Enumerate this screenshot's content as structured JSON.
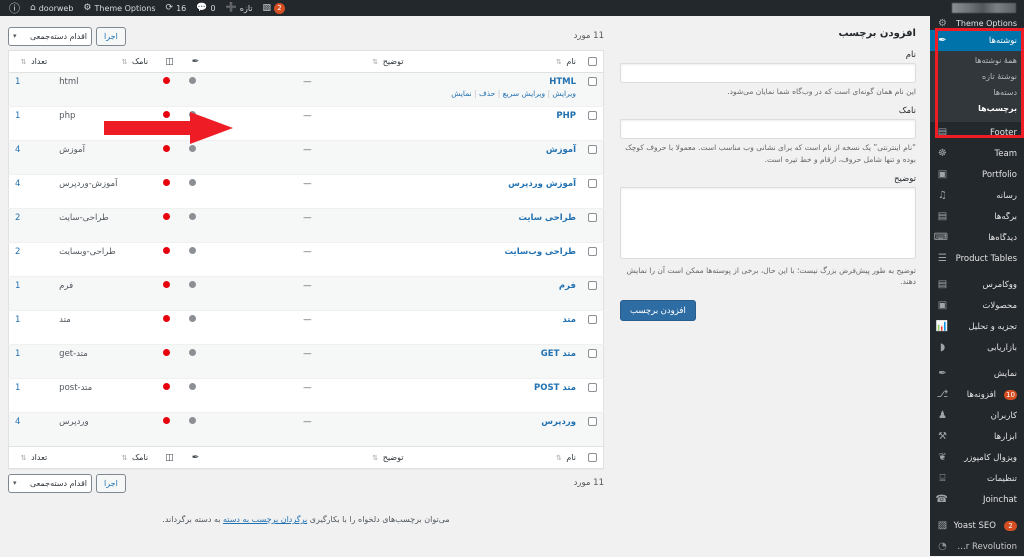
{
  "adminbar": {
    "site_name_redacted": "",
    "right_items": [
      {
        "name": "wp-logo",
        "icon": "wordpress-icon",
        "glyph": "Ⓦ",
        "label": ""
      },
      {
        "name": "site-home",
        "icon": "home-icon",
        "glyph": "⌂",
        "label": ""
      },
      {
        "name": "site-title",
        "icon": "",
        "glyph": "",
        "label": "doorweb"
      },
      {
        "name": "theme-options",
        "icon": "gear-icon",
        "glyph": "⚙",
        "label": "Theme Options"
      },
      {
        "name": "updates",
        "icon": "refresh-icon",
        "glyph": "⟳",
        "label": "16"
      },
      {
        "name": "comments",
        "icon": "comment-icon",
        "glyph": "ὊC",
        "label": "0"
      },
      {
        "name": "new-content",
        "icon": "plus-icon",
        "glyph": "＋",
        "label": "تازه"
      },
      {
        "name": "seo-notifications",
        "icon": "yoast-icon",
        "glyph": "▧",
        "label": "",
        "badge": "2"
      }
    ]
  },
  "sidebar": {
    "items": [
      {
        "label": "نوشته‌ها",
        "icon": "pin-icon",
        "glyph": "✎",
        "current": true,
        "submenu": [
          {
            "label": "همهٔ نوشته‌ها",
            "active": false
          },
          {
            "label": "نوشتهٔ تازه",
            "active": false
          },
          {
            "label": "دسته‌ها",
            "active": false
          },
          {
            "label": "برچسب‌ها",
            "active": true
          }
        ]
      },
      {
        "label": "Footer",
        "icon": "book-icon",
        "glyph": "▤"
      },
      {
        "label": "Team",
        "icon": "people-icon",
        "glyph": "☸"
      },
      {
        "label": "Portfolio",
        "icon": "image-icon",
        "glyph": "▣"
      },
      {
        "label": "رسانه",
        "icon": "media-icon",
        "glyph": "♫"
      },
      {
        "label": "برگه‌ها",
        "icon": "page-icon",
        "glyph": "▤"
      },
      {
        "label": "دیدگاه‌ها",
        "icon": "comment-icon",
        "glyph": "⌨"
      },
      {
        "label": "Product Tables",
        "icon": "list-icon",
        "glyph": "☰"
      },
      {
        "separator": true
      },
      {
        "label": "ووکامرس",
        "icon": "cart-icon",
        "glyph": "▤"
      },
      {
        "label": "محصولات",
        "icon": "box-icon",
        "glyph": "▣"
      },
      {
        "label": "تجزیه و تحلیل",
        "icon": "chart-icon",
        "glyph": "ὌA"
      },
      {
        "label": "بازاریابی",
        "icon": "megaphone-icon",
        "glyph": "◗"
      },
      {
        "separator": true
      },
      {
        "label": "نمایش",
        "icon": "brush-icon",
        "glyph": "✎"
      },
      {
        "label": "افزونه‌ها",
        "icon": "plug-icon",
        "glyph": "⎇",
        "badge": "10"
      },
      {
        "label": "کاربران",
        "icon": "user-icon",
        "glyph": "♟"
      },
      {
        "label": "ابزارها",
        "icon": "tools-icon",
        "glyph": "⚒"
      },
      {
        "label": "ویزوال کامپوزر",
        "icon": "wpbakery-icon",
        "glyph": "❦"
      },
      {
        "label": "تنظیمات",
        "icon": "settings-icon",
        "glyph": "⌸"
      },
      {
        "label": "Joinchat",
        "icon": "whatsapp-icon",
        "glyph": "✆"
      },
      {
        "separator": true
      },
      {
        "label": "Yoast SEO",
        "icon": "yoast-icon",
        "glyph": "▧",
        "badge": "2"
      },
      {
        "label": "Slider Revolution",
        "icon": "slider-icon",
        "glyph": "◔"
      }
    ]
  },
  "form": {
    "heading": "افزودن برچسب",
    "name_label": "نام",
    "name_value": "",
    "name_note": "این نام همان گونه‌ای است که در وب‌گاه شما نمایان می‌شود.",
    "slug_label": "نامک",
    "slug_value": "",
    "slug_note": "“نام اینترنتی” یک نسخه از نام است که برای نشانی وب مناسب است. معمولا با حروف کوچک بوده و تنها شامل حروف، ارقام و خط تیره است.",
    "desc_label": "توضیح",
    "desc_value": "",
    "desc_note": "توضیح به طور پیش‌فرض بزرگ نیست؛ با این حال، برخی از پوسته‌ها ممکن است آن را نمایش دهند.",
    "submit_label": "افزودن برچسب"
  },
  "table": {
    "items_count_top": "11 مورد",
    "items_count_bottom": "11 مورد",
    "bulk_select_label": "اقدام دسته‌جمعی",
    "apply_label": "اجرا",
    "columns": {
      "name": "نام",
      "description": "توضیح",
      "icon1": "brush-icon",
      "icon2": "tag-icon",
      "slug": "نامک",
      "count": "تعداد"
    },
    "row_actions": {
      "edit": "ویرایش",
      "quick_edit": "ویرایش سریع",
      "delete": "حذف",
      "view": "نمایش"
    },
    "rows": [
      {
        "name": "HTML",
        "description": "—",
        "slug": "html",
        "count": "1",
        "show_actions": true
      },
      {
        "name": "PHP",
        "description": "—",
        "slug": "php",
        "count": "1",
        "show_actions": false
      },
      {
        "name": "آموزش",
        "description": "—",
        "slug": "آموزش",
        "count": "4",
        "show_actions": false
      },
      {
        "name": "آموزش وردپرس",
        "description": "—",
        "slug": "آموزش-وردپرس",
        "count": "4",
        "show_actions": false
      },
      {
        "name": "طراحی سایت",
        "description": "—",
        "slug": "طراحی-سایت",
        "count": "2",
        "show_actions": false
      },
      {
        "name": "طراحی وب‌سایت",
        "description": "—",
        "slug": "طراحی-وبسایت",
        "count": "2",
        "show_actions": false
      },
      {
        "name": "فرم",
        "description": "—",
        "slug": "فرم",
        "count": "1",
        "show_actions": false
      },
      {
        "name": "متد",
        "description": "—",
        "slug": "متد",
        "count": "1",
        "show_actions": false
      },
      {
        "name": "متد GET",
        "description": "—",
        "slug": "متد-get",
        "count": "1",
        "show_actions": false
      },
      {
        "name": "متد POST",
        "description": "—",
        "slug": "متد-post",
        "count": "1",
        "show_actions": false
      },
      {
        "name": "وردپرس",
        "description": "—",
        "slug": "وردپرس",
        "count": "4",
        "show_actions": false
      }
    ],
    "footer_hint_before": "می‌توان برچسب‌های دلخواه را با بکارگیری ",
    "footer_hint_link": "برگردان برچسب به دسته",
    "footer_hint_after": " به دسته برگرداند."
  },
  "annotation": {
    "color": "#ee1c25",
    "box_target": "posts-menu-group",
    "arrow_target": "sidebar-submenu-tags"
  }
}
